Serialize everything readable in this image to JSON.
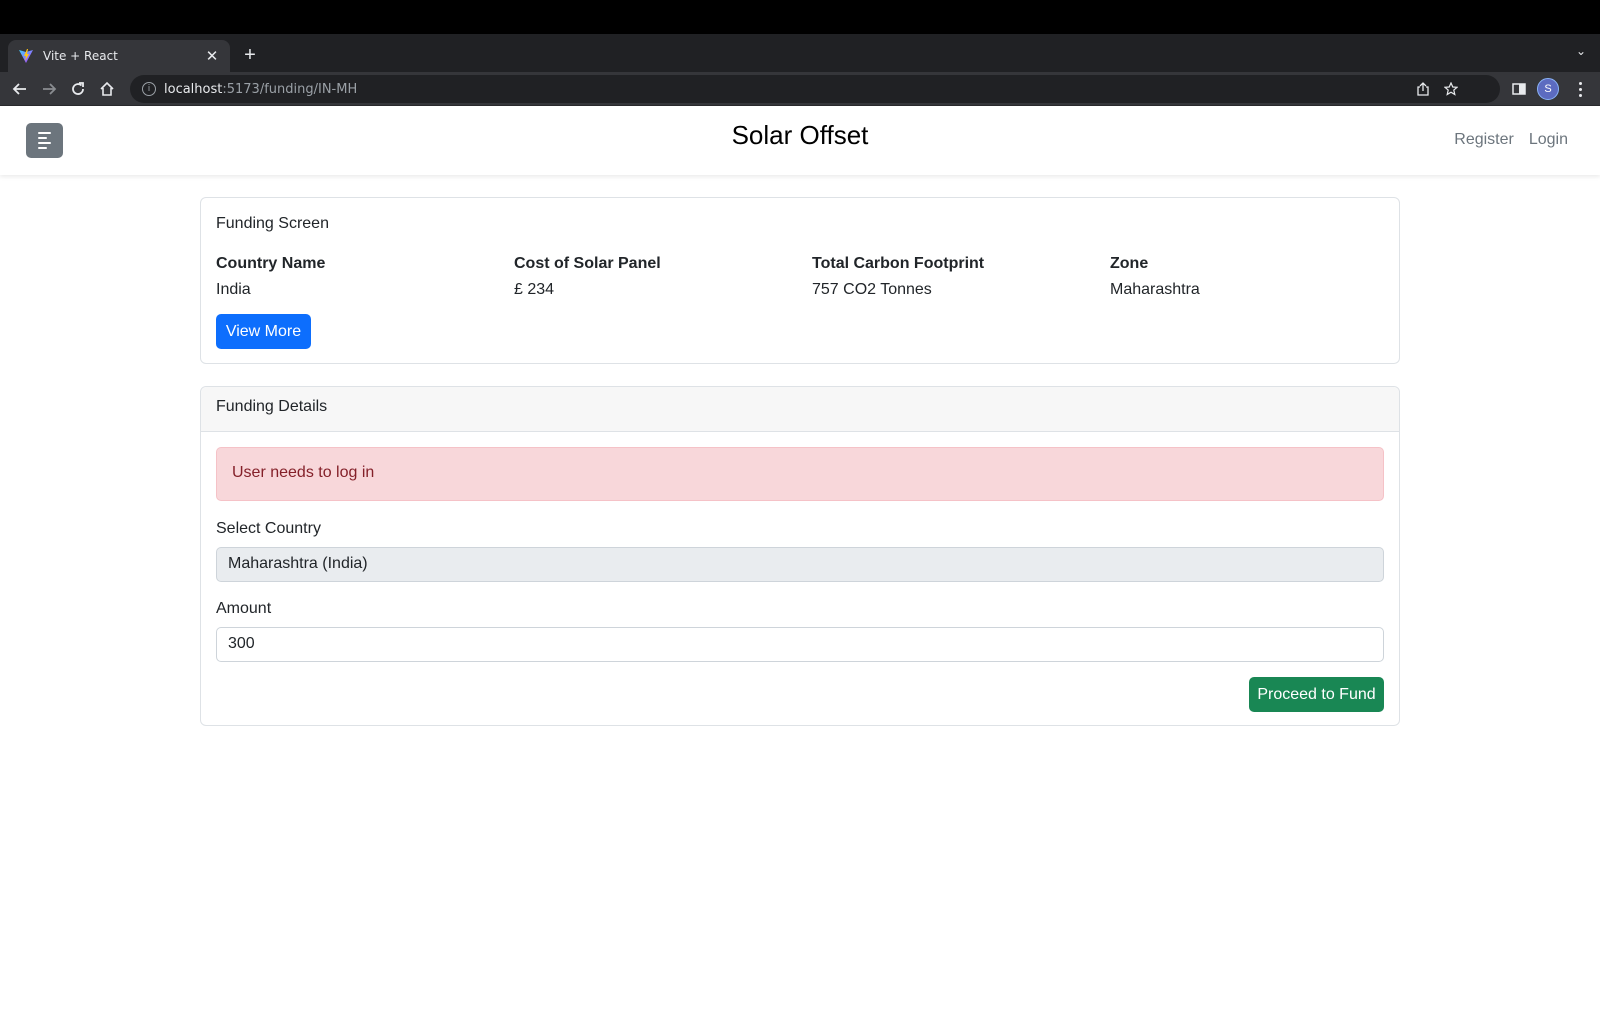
{
  "browser": {
    "tab_title": "Vite + React",
    "url_host": "localhost",
    "url_path": ":5173/funding/IN-MH",
    "profile_initial": "S"
  },
  "header": {
    "title": "Solar Offset",
    "links": [
      "Register",
      "Login"
    ]
  },
  "funding_screen": {
    "title": "Funding Screen",
    "columns": [
      {
        "label": "Country Name",
        "value": "India"
      },
      {
        "label": "Cost of Solar Panel",
        "value": "£ 234"
      },
      {
        "label": "Total Carbon Footprint",
        "value": "757 CO2 Tonnes"
      },
      {
        "label": "Zone",
        "value": "Maharashtra"
      }
    ],
    "view_more_label": "View More"
  },
  "funding_details": {
    "header": "Funding Details",
    "alert": "User needs to log in",
    "country_label": "Select Country",
    "country_value": "Maharashtra (India)",
    "amount_label": "Amount",
    "amount_value": "300",
    "submit_label": "Proceed to Fund"
  },
  "colors": {
    "primary": "#0d6efd",
    "success": "#198754",
    "alert_bg": "#f8d7da",
    "alert_text": "#842029",
    "toggle_bg": "#6c757d"
  }
}
